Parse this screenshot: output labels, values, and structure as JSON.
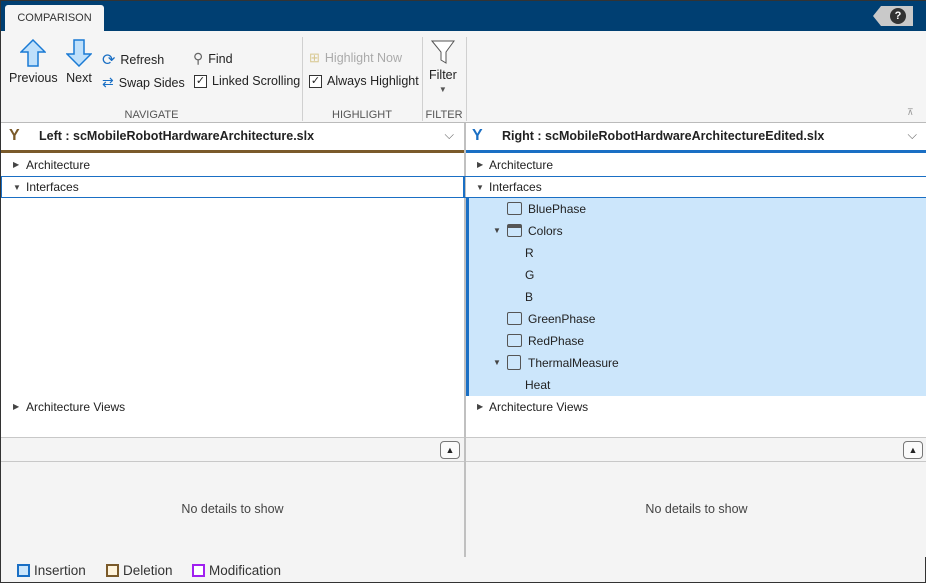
{
  "toolstrip": {
    "tab": "COMPARISON",
    "help_label": "?",
    "navigate": {
      "label": "NAVIGATE",
      "previous": "Previous",
      "next": "Next",
      "refresh": "Refresh",
      "swap": "Swap Sides",
      "find": "Find",
      "linked_scrolling": "Linked Scrolling",
      "linked_checked": true
    },
    "highlight": {
      "label": "HIGHLIGHT",
      "highlight_now": "Highlight Now",
      "always_highlight": "Always Highlight",
      "always_checked": true
    },
    "filter": {
      "label": "FILTER",
      "button": "Filter"
    }
  },
  "left": {
    "title": "Left : scMobileRobotHardwareArchitecture.slx",
    "rows": [
      "Architecture",
      "Interfaces",
      "Architecture Views"
    ],
    "details": "No details to show"
  },
  "right": {
    "title": "Right : scMobileRobotHardwareArchitectureEdited.slx",
    "rows": [
      "Architecture",
      "Interfaces",
      "Architecture Views"
    ],
    "interfaces": [
      "BluePhase",
      "Colors",
      "R",
      "G",
      "B",
      "GreenPhase",
      "RedPhase",
      "ThermalMeasure",
      "Heat"
    ],
    "details": "No details to show"
  },
  "legend": [
    {
      "label": "Insertion",
      "color": "#1a6fc4"
    },
    {
      "label": "Deletion",
      "color": "#7a5a2a"
    },
    {
      "label": "Modification",
      "color": "#a020f0"
    }
  ],
  "colors": {
    "accent": "#003f72",
    "insert_bg": "#cce6fb",
    "insert": "#1a6fc4",
    "delete": "#7a5a2a"
  }
}
